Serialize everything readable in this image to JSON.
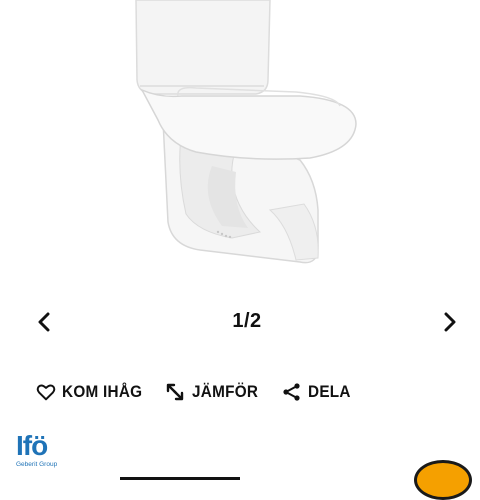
{
  "gallery": {
    "pager": {
      "text": "1/2"
    },
    "icons": {
      "prev": "chevron-left-icon",
      "next": "chevron-right-icon"
    }
  },
  "actions": {
    "remember": {
      "label": "KOM IHÅG",
      "icon": "heart-icon"
    },
    "compare": {
      "label": "JÄMFÖR",
      "icon": "compare-arrows-icon"
    },
    "share": {
      "label": "DELA",
      "icon": "share-icon"
    }
  },
  "brand": {
    "logo": "Ifö",
    "subtitle": "Geberit Group",
    "color": "#1f73b7"
  },
  "colors": {
    "badge": "#f5a000",
    "text": "#111111"
  }
}
